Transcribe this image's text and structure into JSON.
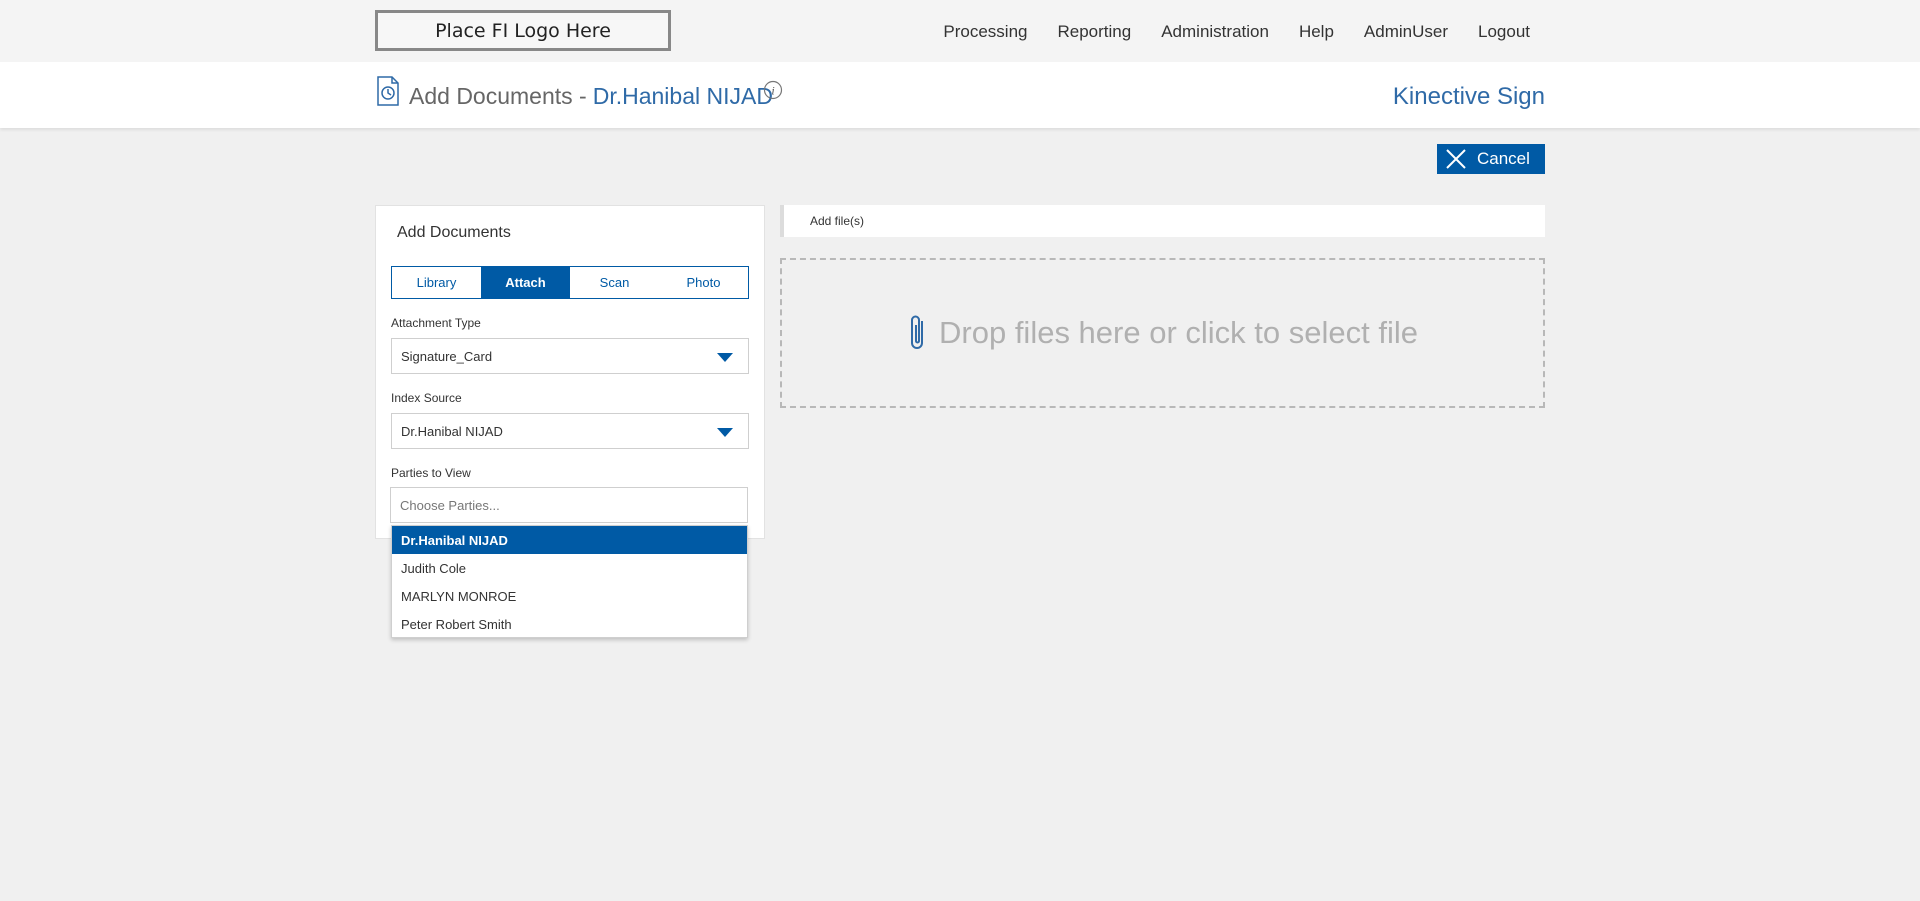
{
  "topbar": {
    "logo_text": "Place FI Logo Here",
    "nav": [
      "Processing",
      "Reporting",
      "Administration",
      "Help",
      "AdminUser",
      "Logout"
    ]
  },
  "header": {
    "title": "Add Documents -",
    "party": "Dr.Hanibal NIJAD",
    "brand": "Kinective Sign",
    "icons": [
      "document-history-icon",
      "info-icon"
    ]
  },
  "actions": {
    "cancel_label": "Cancel",
    "cancel_icon": "close-icon"
  },
  "panel": {
    "title": "Add Documents",
    "tabs": [
      {
        "label": "Library",
        "active": false
      },
      {
        "label": "Attach",
        "active": true
      },
      {
        "label": "Scan",
        "active": false
      },
      {
        "label": "Photo",
        "active": false
      }
    ],
    "attachment_type": {
      "label": "Attachment Type",
      "value": "Signature_Card"
    },
    "index_source": {
      "label": "Index Source",
      "value": "Dr.Hanibal NIJAD"
    },
    "parties": {
      "label": "Parties to View",
      "placeholder": "Choose Parties...",
      "options": [
        "Dr.Hanibal NIJAD",
        "Judith Cole",
        "MARLYN MONROE",
        "Peter Robert Smith"
      ],
      "highlighted": "Dr.Hanibal NIJAD"
    }
  },
  "files": {
    "header_label": "Add file(s)",
    "drop_text": "Drop files here or click to select file",
    "drop_icon": "paperclip-icon"
  },
  "colors": {
    "accent": "#005aa5",
    "brand": "#2f6aa7",
    "background": "#f0f0f0"
  }
}
